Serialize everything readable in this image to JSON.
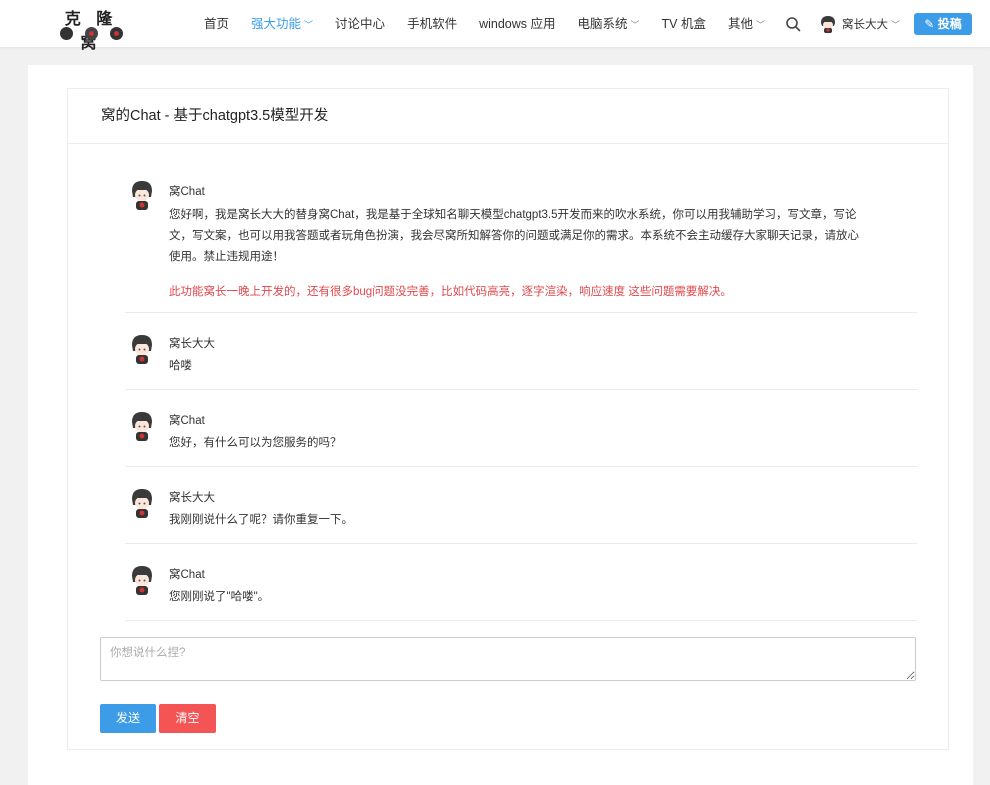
{
  "header": {
    "logo_text": "克 隆 窝",
    "nav": [
      {
        "label": "首页",
        "caret": false,
        "active": false
      },
      {
        "label": "强大功能",
        "caret": true,
        "active": true
      },
      {
        "label": "讨论中心",
        "caret": false,
        "active": false
      },
      {
        "label": "手机软件",
        "caret": false,
        "active": false
      },
      {
        "label": "windows 应用",
        "caret": false,
        "active": false
      },
      {
        "label": "电脑系统",
        "caret": true,
        "active": false
      },
      {
        "label": "TV 机盒",
        "caret": false,
        "active": false
      },
      {
        "label": "其他",
        "caret": true,
        "active": false
      }
    ],
    "user_name": "窝长大大",
    "post_label": "投稿"
  },
  "chat": {
    "title": "窝的Chat - 基于chatgpt3.5模型开发",
    "messages": [
      {
        "sender": "窝Chat",
        "text": "您好啊，我是窝长大大的替身窝Chat，我是基于全球知名聊天模型chatgpt3.5开发而来的吹水系统，你可以用我辅助学习，写文章，写论文，写文案，也可以用我答题或者玩角色扮演，我会尽窝所知解答你的问题或满足你的需求。本系统不会主动缓存大家聊天记录，请放心使用。禁止违规用途！",
        "note": "此功能窝长一晚上开发的，还有很多bug问题没完善，比如代码高亮，逐字渲染，响应速度 这些问题需要解决。"
      },
      {
        "sender": "窝长大大",
        "text": "哈喽",
        "note": ""
      },
      {
        "sender": "窝Chat",
        "text": "您好，有什么可以为您服务的吗？",
        "note": ""
      },
      {
        "sender": "窝长大大",
        "text": "我刚刚说什么了呢？请你重复一下。",
        "note": ""
      },
      {
        "sender": "窝Chat",
        "text": "您刚刚说了\"哈喽\"。",
        "note": ""
      }
    ],
    "input_placeholder": "你想说什么捏?",
    "send_label": "发送",
    "clear_label": "清空"
  },
  "colors": {
    "accent": "#3c9ce8",
    "danger": "#f45454",
    "note": "#e0484c"
  }
}
